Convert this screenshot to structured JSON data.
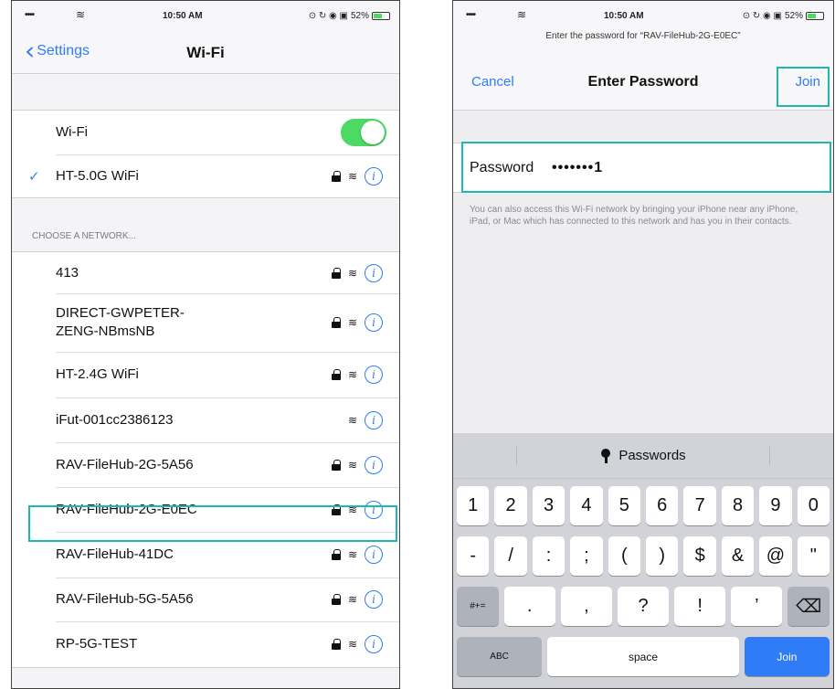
{
  "left": {
    "status": {
      "signal": "••••",
      "time": "10:50 AM",
      "indicators": "⊙ ↻ ◉ ▣",
      "battery": "52%",
      "battery_level": 0.52
    },
    "nav": {
      "back_label": "Settings",
      "title": "Wi-Fi"
    },
    "wifi_toggle": {
      "label": "Wi-Fi",
      "on": true
    },
    "connected": {
      "name": "HT-5.0G WiFi",
      "secured": true
    },
    "section_header": "CHOOSE A NETWORK...",
    "networks": [
      {
        "name": "413",
        "secured": true
      },
      {
        "name": "DIRECT-GWPETER-ZENG-NBmsNB",
        "line1": "DIRECT-GWPETER-",
        "line2": "ZENG-NBmsNB",
        "secured": true
      },
      {
        "name": "HT-2.4G WiFi",
        "secured": true
      },
      {
        "name": "iFut-001cc2386123",
        "secured": false
      },
      {
        "name": "RAV-FileHub-2G-5A56",
        "secured": true
      },
      {
        "name": "RAV-FileHub-2G-E0EC",
        "secured": true
      },
      {
        "name": "RAV-FileHub-41DC",
        "secured": true
      },
      {
        "name": "RAV-FileHub-5G-5A56",
        "secured": true
      },
      {
        "name": "RP-5G-TEST",
        "secured": true
      }
    ],
    "highlight_color": "#1fb8ad"
  },
  "right": {
    "status": {
      "signal": "••••",
      "time": "10:50 AM",
      "indicators": "⊙ ↻ ◉ ▣",
      "battery": "52%"
    },
    "prompt": "Enter the password for “RAV-FileHub-2G-E0EC”",
    "nav": {
      "cancel": "Cancel",
      "title": "Enter Password",
      "join": "Join"
    },
    "password": {
      "label": "Password",
      "value": "•••••••1"
    },
    "note": "You can also access this Wi-Fi network by bringing your iPhone near any iPhone, iPad, or Mac which has connected to this network and has you in their contacts.",
    "keyboard": {
      "quicktype": "Passwords",
      "row1": [
        "1",
        "2",
        "3",
        "4",
        "5",
        "6",
        "7",
        "8",
        "9",
        "0"
      ],
      "row2": [
        "-",
        "/",
        ":",
        ";",
        "(",
        ")",
        "$",
        "&",
        "@",
        "\""
      ],
      "row3": {
        "shift": "#+=",
        "keys": [
          ".",
          ",",
          "?",
          "!",
          "’"
        ],
        "delete": "⌫"
      },
      "row4": {
        "abc": "ABC",
        "space": "space",
        "join": "Join"
      }
    }
  }
}
